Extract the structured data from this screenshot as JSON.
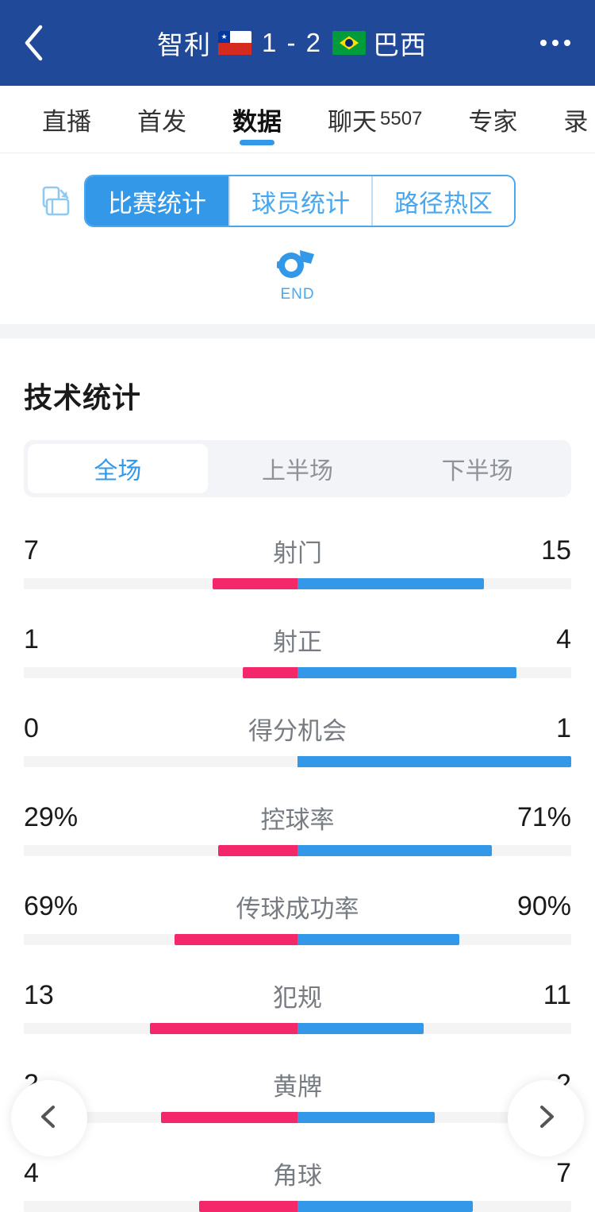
{
  "header": {
    "back_icon": "chevron-left-icon",
    "home_team": "智利",
    "home_flag": "chile-flag-icon",
    "score": "1 - 2",
    "away_flag": "brazil-flag-icon",
    "away_team": "巴西",
    "more_icon": "more-horizontal-icon",
    "background_color": "#21499A"
  },
  "tabbar": {
    "items": [
      {
        "label": "直播",
        "badge": "",
        "active": false
      },
      {
        "label": "首发",
        "badge": "",
        "active": false
      },
      {
        "label": "数据",
        "badge": "",
        "active": true
      },
      {
        "label": "聊天",
        "badge": "5507",
        "active": false
      },
      {
        "label": "专家",
        "badge": "",
        "active": false
      },
      {
        "label": "录",
        "badge": "",
        "active": false
      }
    ],
    "active_indicator_color": "#3498E8"
  },
  "seg_section": {
    "rotate_icon": "rotate-screen-icon",
    "segments": [
      {
        "label": "比赛统计",
        "active": true
      },
      {
        "label": "球员统计",
        "active": false
      },
      {
        "label": "路径热区",
        "active": false
      }
    ],
    "status_icon": "whistle-icon",
    "status_label": "END",
    "accent_color": "#49A7F0"
  },
  "stats": {
    "title": "技术统计",
    "half_tabs": [
      {
        "label": "全场",
        "active": true
      },
      {
        "label": "上半场",
        "active": false
      },
      {
        "label": "下半场",
        "active": false
      }
    ]
  },
  "chart_data": {
    "type": "bar",
    "title": "技术统计",
    "orientation": "diverging-horizontal",
    "legend": [
      "智利",
      "巴西"
    ],
    "colors": {
      "home": "#F5276B",
      "away": "#3498E8",
      "track": "#F4F4F5"
    },
    "categories": [
      "射门",
      "射正",
      "得分机会",
      "控球率",
      "传球成功率",
      "犯规",
      "黄牌",
      "角球"
    ],
    "series": [
      {
        "name": "智利",
        "values": [
          "7",
          "1",
          "0",
          "29%",
          "69%",
          "13",
          "2",
          "4"
        ]
      },
      {
        "name": "巴西",
        "values": [
          "15",
          "4",
          "1",
          "71%",
          "90%",
          "11",
          "2",
          "7"
        ]
      }
    ],
    "rows": [
      {
        "label": "射门",
        "home": "7",
        "away": "15",
        "home_pct": 31,
        "away_pct": 68
      },
      {
        "label": "射正",
        "home": "1",
        "away": "4",
        "home_pct": 20,
        "away_pct": 80
      },
      {
        "label": "得分机会",
        "home": "0",
        "away": "1",
        "home_pct": 0,
        "away_pct": 100
      },
      {
        "label": "控球率",
        "home": "29%",
        "away": "71%",
        "home_pct": 29,
        "away_pct": 71
      },
      {
        "label": "传球成功率",
        "home": "69%",
        "away": "90%",
        "home_pct": 45,
        "away_pct": 59
      },
      {
        "label": "犯规",
        "home": "13",
        "away": "11",
        "home_pct": 54,
        "away_pct": 46
      },
      {
        "label": "黄牌",
        "home": "2",
        "away": "2",
        "home_pct": 50,
        "away_pct": 50
      },
      {
        "label": "角球",
        "home": "4",
        "away": "7",
        "home_pct": 36,
        "away_pct": 64
      }
    ]
  },
  "floating": {
    "prev_icon": "chevron-left-circle-icon",
    "next_icon": "chevron-right-circle-icon"
  }
}
